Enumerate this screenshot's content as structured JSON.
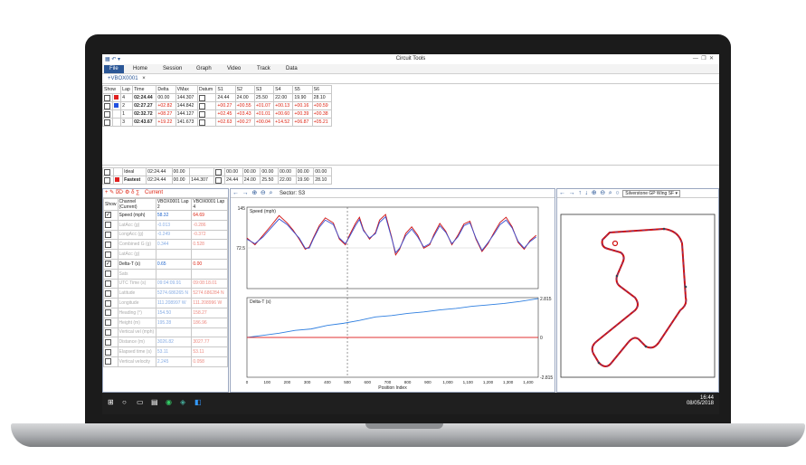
{
  "app": {
    "title": "Circuit Tools"
  },
  "ribbon": {
    "tabs": [
      "File",
      "Home",
      "Session",
      "Graph",
      "Video",
      "Track",
      "Data"
    ]
  },
  "doc_tab": {
    "label": "+VBOX0001",
    "close": "×"
  },
  "lap_table": {
    "headers": [
      "Show",
      "Lap",
      "Time",
      "Delta",
      "VMax",
      "Datum",
      "S1",
      "S2",
      "S3",
      "S4",
      "S5",
      "S6"
    ],
    "rows": [
      {
        "show": true,
        "color": "#e02020",
        "lap": "4",
        "time": "02:24.44",
        "delta": "00.00",
        "vmax": "144.307",
        "datum": true,
        "s": [
          "24.44",
          "24.00",
          "25.50",
          "22.00",
          "19.90",
          "28.10"
        ]
      },
      {
        "show": true,
        "color": "#2050e0",
        "lap": "2",
        "time": "02:27.27",
        "delta": "+02.82",
        "vmax": "144.842",
        "datum": false,
        "s": [
          "+00.27",
          "+00.55",
          "+01.07",
          "+00.13",
          "+00.16",
          "+00.59"
        ]
      },
      {
        "show": false,
        "color": "",
        "lap": "1",
        "time": "02:32.72",
        "delta": "+08.27",
        "vmax": "144.127",
        "datum": false,
        "s": [
          "+02.45",
          "+03.43",
          "+01.01",
          "+00.60",
          "+00.39",
          "+00.38"
        ]
      },
      {
        "show": false,
        "color": "",
        "lap": "3",
        "time": "02:43.67",
        "delta": "+19.22",
        "vmax": "141.673",
        "datum": false,
        "s": [
          "+02.63",
          "+00.27",
          "+00.04",
          "+14.52",
          "+06.87",
          "+05.21"
        ]
      }
    ],
    "footer": [
      {
        "show": false,
        "label": "Ideal",
        "time": "02:24.44",
        "delta": "00.00",
        "vmax": "",
        "s": [
          "00.00",
          "00.00",
          "00.00",
          "00.00",
          "00.00",
          "00.00"
        ]
      },
      {
        "show": true,
        "label": "Fastest",
        "time": "02:24.44",
        "delta": "00.00",
        "vmax": "144.307",
        "s": [
          "24.44",
          "24.00",
          "25.50",
          "22.00",
          "19.90",
          "28.10"
        ]
      }
    ]
  },
  "channel_panel": {
    "toolbar_label": "Current",
    "headers": {
      "show": "Show",
      "channel": "Channel (Current)",
      "lap_a": "VBOX0001 Lap 2",
      "lap_b": "VBOX0001 Lap 4"
    },
    "rows": [
      {
        "show": true,
        "name": "Speed (mph)",
        "a": "58.32",
        "b": "64.69",
        "active": true
      },
      {
        "show": false,
        "name": "LatAcc (g)",
        "a": "-0.013",
        "b": "-0.286",
        "active": false
      },
      {
        "show": false,
        "name": "LongAcc (g)",
        "a": "-0.249",
        "b": "-0.372",
        "active": false
      },
      {
        "show": false,
        "name": "Combined G (g)",
        "a": "0.344",
        "b": "0.528",
        "active": false
      },
      {
        "show": false,
        "name": "LatAcc (g)",
        "a": "",
        "b": "",
        "active": false
      },
      {
        "show": true,
        "name": "Delta-T (s)",
        "a": "0.65",
        "b": "0.00",
        "active": true
      },
      {
        "show": false,
        "name": "Sats",
        "a": "",
        "b": "",
        "active": false
      },
      {
        "show": false,
        "name": "UTC Time (s)",
        "a": "09:04:09.91",
        "b": "09:08:18.01",
        "active": false
      },
      {
        "show": false,
        "name": "Latitude",
        "a": "5274.686265 N",
        "b": "5274.686284 N",
        "active": false
      },
      {
        "show": false,
        "name": "Longitude",
        "a": "111.208997 W",
        "b": "111.208996 W",
        "active": false
      },
      {
        "show": false,
        "name": "Heading (°)",
        "a": "154.50",
        "b": "158.27",
        "active": false
      },
      {
        "show": false,
        "name": "Height (m)",
        "a": "195.28",
        "b": "186.96",
        "active": false
      },
      {
        "show": false,
        "name": "Vertical vel (mph)",
        "a": "",
        "b": "",
        "active": false
      },
      {
        "show": false,
        "name": "Distance (m)",
        "a": "3026.82",
        "b": "3027.77",
        "active": false
      },
      {
        "show": false,
        "name": "Elapsed time (s)",
        "a": "53.11",
        "b": "53.11",
        "active": false
      },
      {
        "show": false,
        "name": "Vertical velocity",
        "a": "2.245",
        "b": "0.058",
        "active": false
      }
    ]
  },
  "graph": {
    "sector_label": "Sector: S3",
    "speed_label": "Speed (mph)",
    "delta_label": "Delta-T (s)",
    "x_title": "Position Index",
    "x_ticks": [
      "0",
      "100",
      "200",
      "300",
      "400",
      "500",
      "600",
      "700",
      "800",
      "900",
      "1,000",
      "1,100",
      "1,200",
      "1,300",
      "1,400"
    ],
    "speed_ticks": [
      "145",
      "72.5"
    ],
    "delta_ticks": [
      "2.815",
      "0",
      "-2.815"
    ]
  },
  "chart_data": {
    "type": "line",
    "x_range": [
      0,
      1450
    ],
    "speed": {
      "ylim": [
        0,
        145
      ],
      "series": [
        {
          "color": "#d01010",
          "x": [
            0,
            40,
            80,
            120,
            160,
            200,
            230,
            260,
            290,
            310,
            330,
            360,
            390,
            430,
            460,
            490,
            510,
            540,
            560,
            580,
            610,
            640,
            660,
            690,
            720,
            740,
            760,
            790,
            820,
            850,
            880,
            910,
            930,
            960,
            990,
            1020,
            1050,
            1080,
            1110,
            1140,
            1170,
            1200,
            1230,
            1260,
            1290,
            1320,
            1350,
            1380,
            1410,
            1440
          ],
          "y": [
            90,
            78,
            95,
            112,
            130,
            117,
            104,
            88,
            70,
            74,
            90,
            112,
            126,
            117,
            88,
            78,
            95,
            116,
            127,
            105,
            88,
            100,
            122,
            132,
            92,
            60,
            70,
            98,
            110,
            95,
            72,
            78,
            96,
            116,
            102,
            78,
            95,
            115,
            120,
            88,
            66,
            80,
            100,
            118,
            127,
            110,
            82,
            70,
            86,
            95
          ]
        },
        {
          "color": "#3a4fd0",
          "x": [
            0,
            40,
            80,
            120,
            160,
            200,
            230,
            260,
            290,
            310,
            330,
            360,
            390,
            430,
            460,
            490,
            510,
            540,
            560,
            580,
            610,
            640,
            660,
            690,
            720,
            740,
            760,
            790,
            820,
            850,
            880,
            910,
            930,
            960,
            990,
            1020,
            1050,
            1080,
            1110,
            1140,
            1170,
            1200,
            1230,
            1260,
            1290,
            1320,
            1350,
            1380,
            1410,
            1440
          ],
          "y": [
            88,
            80,
            92,
            108,
            124,
            114,
            102,
            90,
            72,
            72,
            88,
            109,
            122,
            114,
            90,
            80,
            92,
            112,
            123,
            103,
            90,
            98,
            118,
            128,
            90,
            64,
            72,
            94,
            106,
            92,
            74,
            80,
            93,
            112,
            100,
            80,
            92,
            112,
            117,
            90,
            68,
            82,
            97,
            114,
            122,
            108,
            84,
            72,
            84,
            92
          ]
        }
      ]
    },
    "delta": {
      "ylim": [
        -2.815,
        2.815
      ],
      "series": [
        {
          "color": "#2f7fe0",
          "x": [
            0,
            80,
            160,
            240,
            320,
            400,
            480,
            560,
            640,
            720,
            800,
            880,
            960,
            1040,
            1120,
            1200,
            1280,
            1360,
            1450
          ],
          "y": [
            0,
            0.15,
            0.3,
            0.5,
            0.6,
            0.85,
            1.0,
            1.2,
            1.45,
            1.55,
            1.7,
            1.8,
            1.95,
            2.05,
            2.2,
            2.3,
            2.4,
            2.55,
            2.75
          ]
        },
        {
          "color": "#e03030",
          "x": [
            0,
            1450
          ],
          "y": [
            0,
            0
          ]
        }
      ]
    }
  },
  "map": {
    "track": "Silverstone GP Wing SF",
    "dropdown_arrow": "▾"
  },
  "taskbar": {
    "time": "16:44",
    "date": "08/05/2018"
  },
  "colors": {
    "accent": "#2b5797",
    "lap_red": "#e02020",
    "lap_blue": "#2050e0"
  }
}
